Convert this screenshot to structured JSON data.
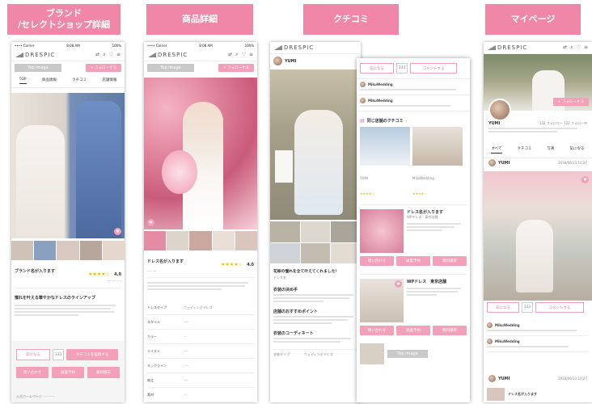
{
  "headers": {
    "brand_line1": "ブランド",
    "brand_line2": "/セレクトショップ詳細",
    "product": "商品詳細",
    "review": "クチコミ",
    "mypage": "マイページ"
  },
  "common": {
    "logo": "DRESPIC",
    "follow": "+ フォローする",
    "img_placeholder": "Top image",
    "status_left": "•••• Carrier",
    "status_time": "8:08 AM",
    "status_right": "100%",
    "colors": {
      "accent": "#f086a8",
      "button": "#f4a0b8",
      "star": "#f2b800"
    }
  },
  "brand": {
    "tabs": [
      "TOP",
      "商品情報",
      "クチコミ",
      "店舗情報"
    ],
    "name": "ブランド名が入ります",
    "rating": "4.0",
    "headline": "憧れを叶える華やかなドレスのラインアップ",
    "btn_favorite": "気になる",
    "btn_count": "333",
    "btn_review": "クチコミを投稿する",
    "btn_row": [
      "問い合わせ",
      "試着予約",
      "資料請求"
    ],
    "footer": "公式ホームページ"
  },
  "product": {
    "name": "ドレス名が入ります",
    "rating": "4.0",
    "specs": [
      "ドレスタイプ",
      "スタイル",
      "カラー",
      "テイスト",
      "ネックライン",
      "袖丈",
      "素材"
    ],
    "spec_value": "ウェディングドレス"
  },
  "review": {
    "user": "YUMI",
    "btn_like": "気になる",
    "btn_count": "333",
    "btn_comment": "コメントする",
    "commenter": "MikuWedding",
    "same_shop": "同じ店舗のクチコミ",
    "title": "花嫁の憧れを全て叶えてくれました！",
    "dress_label": "ドレス名",
    "section1": "衣装の決め手",
    "section2": "店舗のおすすめポイント",
    "section3": "衣装のコーディネート",
    "card_title": "ドレス名が入ります",
    "card_sub": "WPドレス　東京店舗",
    "card_btns": [
      "問い合わせ",
      "試着予約",
      "資料請求"
    ],
    "spec_label": "衣装タイプ",
    "spec_value": "ウェディングドレス"
  },
  "mypage": {
    "user": "YUMI",
    "followers": "132 フォロワー",
    "following": "122 フォロー中",
    "tabs": [
      "すべて",
      "クチコミ",
      "写真",
      "気になる"
    ],
    "date": "2018/06/13 10:27",
    "btn_like": "気になる",
    "btn_count": "333",
    "btn_comment": "コメントする",
    "commenter": "MikuWedding",
    "post_title": "ドレス名が入ります"
  }
}
